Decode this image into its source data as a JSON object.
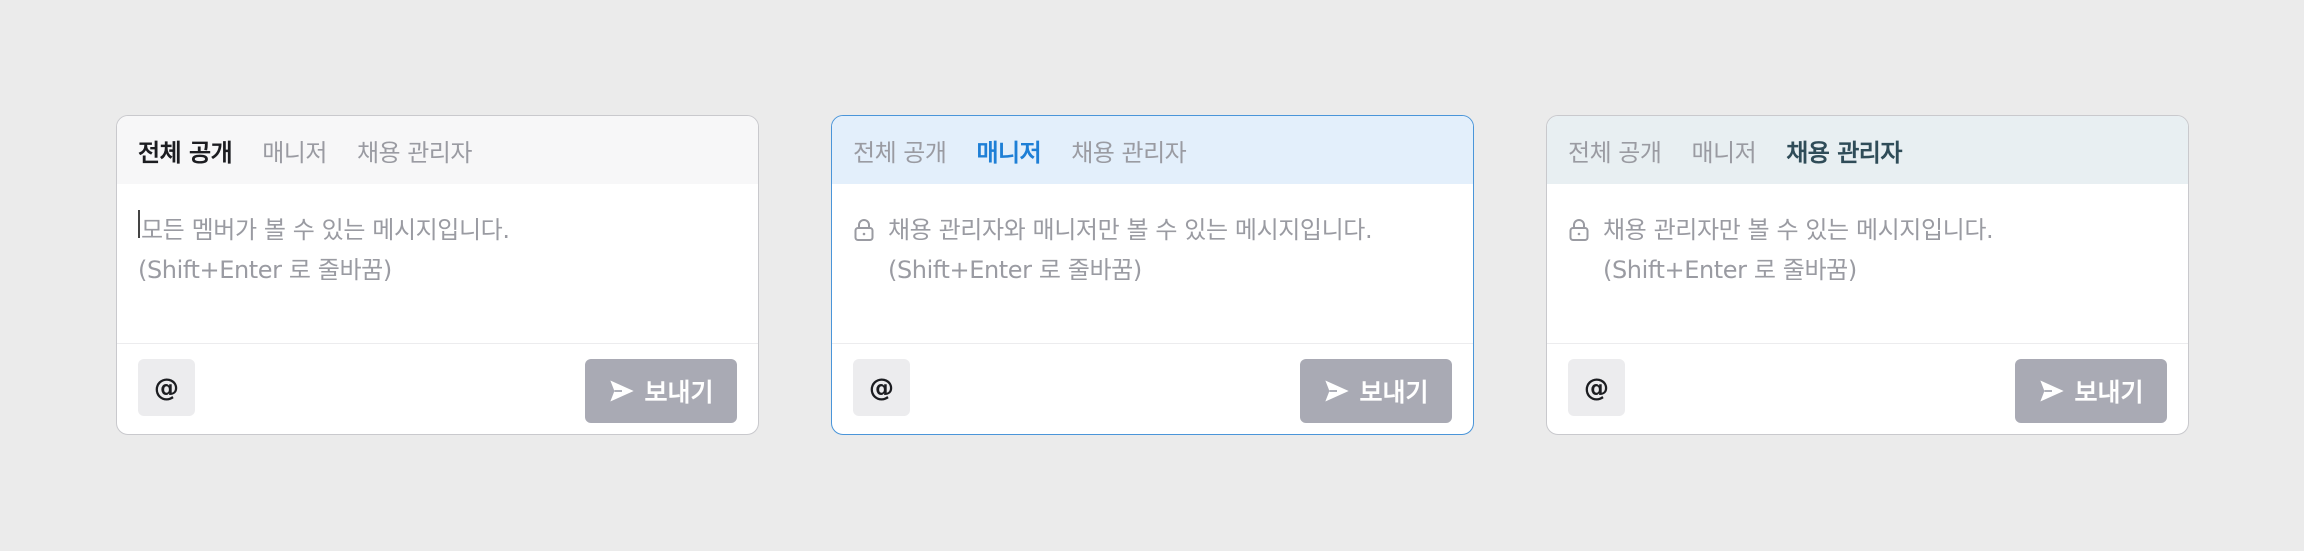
{
  "tabs": [
    "전체 공개",
    "매니저",
    "채용 관리자"
  ],
  "cards": [
    {
      "active_tab": 0,
      "line1": "모든 멤버가 볼 수 있는 메시지입니다.",
      "line2": "(Shift+Enter 로 줄바꿈)",
      "show_lock": false,
      "show_caret": true
    },
    {
      "active_tab": 1,
      "line1": "채용 관리자와 매니저만 볼 수 있는 메시지입니다.",
      "line2": "(Shift+Enter 로 줄바꿈)",
      "show_lock": true,
      "show_caret": false
    },
    {
      "active_tab": 2,
      "line1": "채용 관리자만 볼 수 있는 메시지입니다.",
      "line2": "(Shift+Enter 로 줄바꿈)",
      "show_lock": true,
      "show_caret": false
    }
  ],
  "mention_label": "@",
  "send_label": "보내기",
  "icons": {
    "lock": "lock-icon",
    "send": "send-icon"
  },
  "colors": {
    "manager_accent": "#1e7fd6",
    "recruiter_accent": "#2f4c58",
    "send_button": "#a9aab4"
  }
}
